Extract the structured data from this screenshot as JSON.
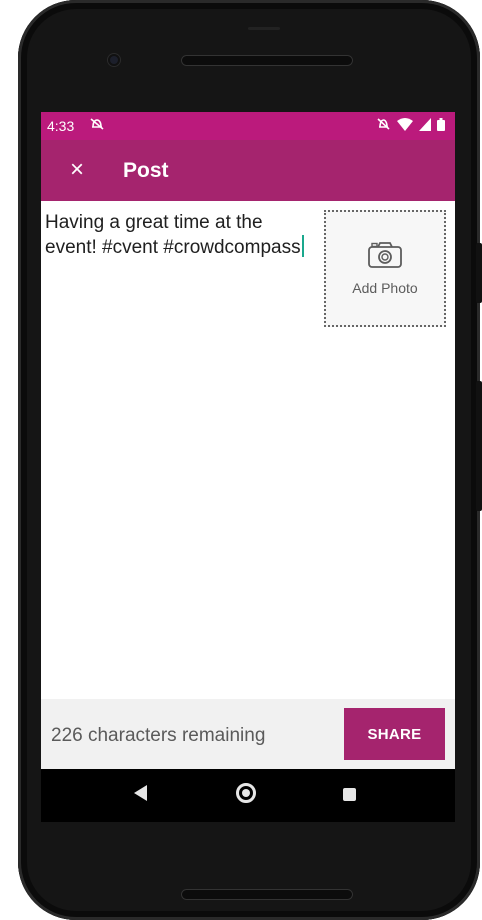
{
  "status_bar": {
    "time": "4:33",
    "icons": [
      "notifications-off-icon",
      "mute-icon",
      "wifi-icon",
      "signal-icon",
      "battery-icon"
    ]
  },
  "app_bar": {
    "close_icon": "×",
    "title": "Post"
  },
  "compose": {
    "text": "Having a great time at the event! #cvent #crowdcompass",
    "add_photo_label": "Add Photo"
  },
  "footer": {
    "remaining_text": "226 characters remaining",
    "share_label": "SHARE"
  },
  "colors": {
    "status_bar": "#bb1a7c",
    "app_bar": "#a5246e",
    "share_button": "#a5246e",
    "caret": "#1aa88d"
  }
}
